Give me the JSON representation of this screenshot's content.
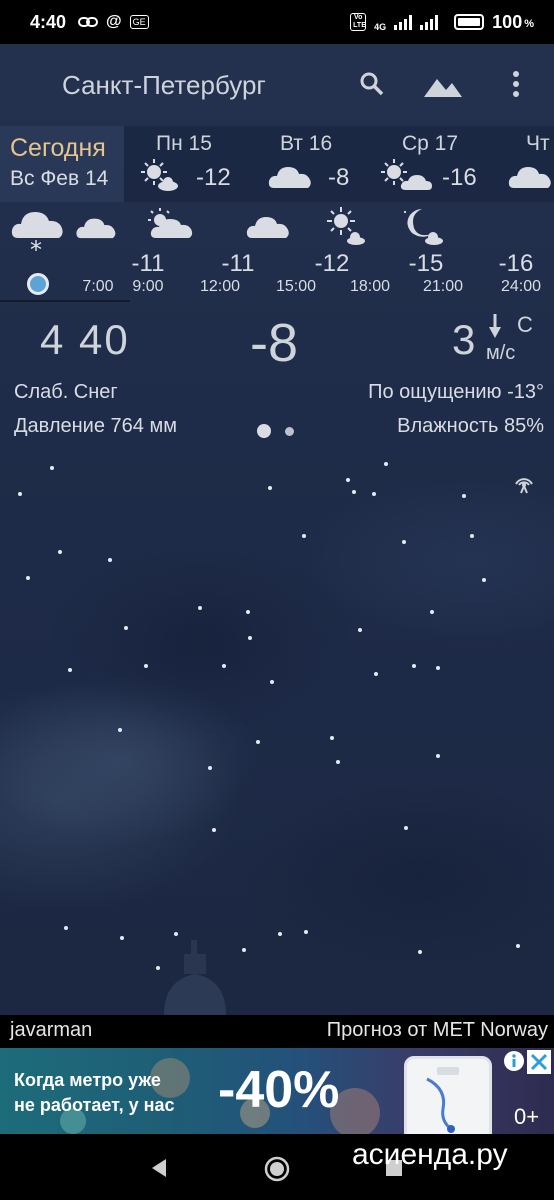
{
  "status_bar": {
    "time": "4:40",
    "battery": "100",
    "battery_unit": "%",
    "network": "4G",
    "volte": "Vo LTE"
  },
  "header": {
    "city": "Санкт-Петербург",
    "icons": [
      "search-icon",
      "landscape-icon",
      "more-vert-icon"
    ]
  },
  "days": {
    "today": {
      "label": "Сегодня",
      "date": "Вс Фев 14"
    },
    "items": [
      {
        "name": "Пн 15",
        "temp": "-12",
        "icon": "sun-cloud-icon"
      },
      {
        "name": "Вт 16",
        "temp": "-8",
        "icon": "cloud-icon"
      },
      {
        "name": "Ср 17",
        "temp": "-16",
        "icon": "sun-cloud-icon"
      },
      {
        "name": "Чт",
        "temp": "",
        "icon": "cloud-icon"
      }
    ]
  },
  "hourly": [
    {
      "time": "7:00",
      "temp": "",
      "icon": "cloud-snow-icon"
    },
    {
      "time": "9:00",
      "temp": "-11",
      "icon": "cloud-icon"
    },
    {
      "time": "12:00",
      "temp": "-11",
      "icon": "sun-cloud-icon"
    },
    {
      "time": "15:00",
      "temp": "-11",
      "icon": "cloud-icon"
    },
    {
      "time": "18:00",
      "temp": "-12",
      "icon": "sun-cloud-icon"
    },
    {
      "time": "21:00",
      "temp": "-15",
      "icon": "moon-cloud-icon"
    },
    {
      "time": "24:00",
      "temp": "-16",
      "icon": ""
    }
  ],
  "current": {
    "time": "4 40",
    "temp": "-8",
    "wind_speed": "3",
    "wind_dir": "С",
    "wind_unit": "м/с",
    "condition": "Слаб. Снег",
    "feels_like": "По ощущению -13°",
    "pressure": "Давление 764 мм",
    "humidity": "Влажность 85%"
  },
  "credits": {
    "author": "javarman",
    "source": "Прогноз от MET Norway"
  },
  "ad": {
    "line1": "Когда метро уже",
    "line2": "не работает, у нас",
    "discount": "-40%",
    "age": "0+"
  },
  "navbar": {
    "buttons": [
      "back-icon",
      "home-icon",
      "recents-icon"
    ]
  },
  "watermark": "асиенда.ру",
  "colors": {
    "today_accent": "#e4c48f",
    "now_dot": "#5da4d6",
    "sky": "#1f2c49"
  }
}
